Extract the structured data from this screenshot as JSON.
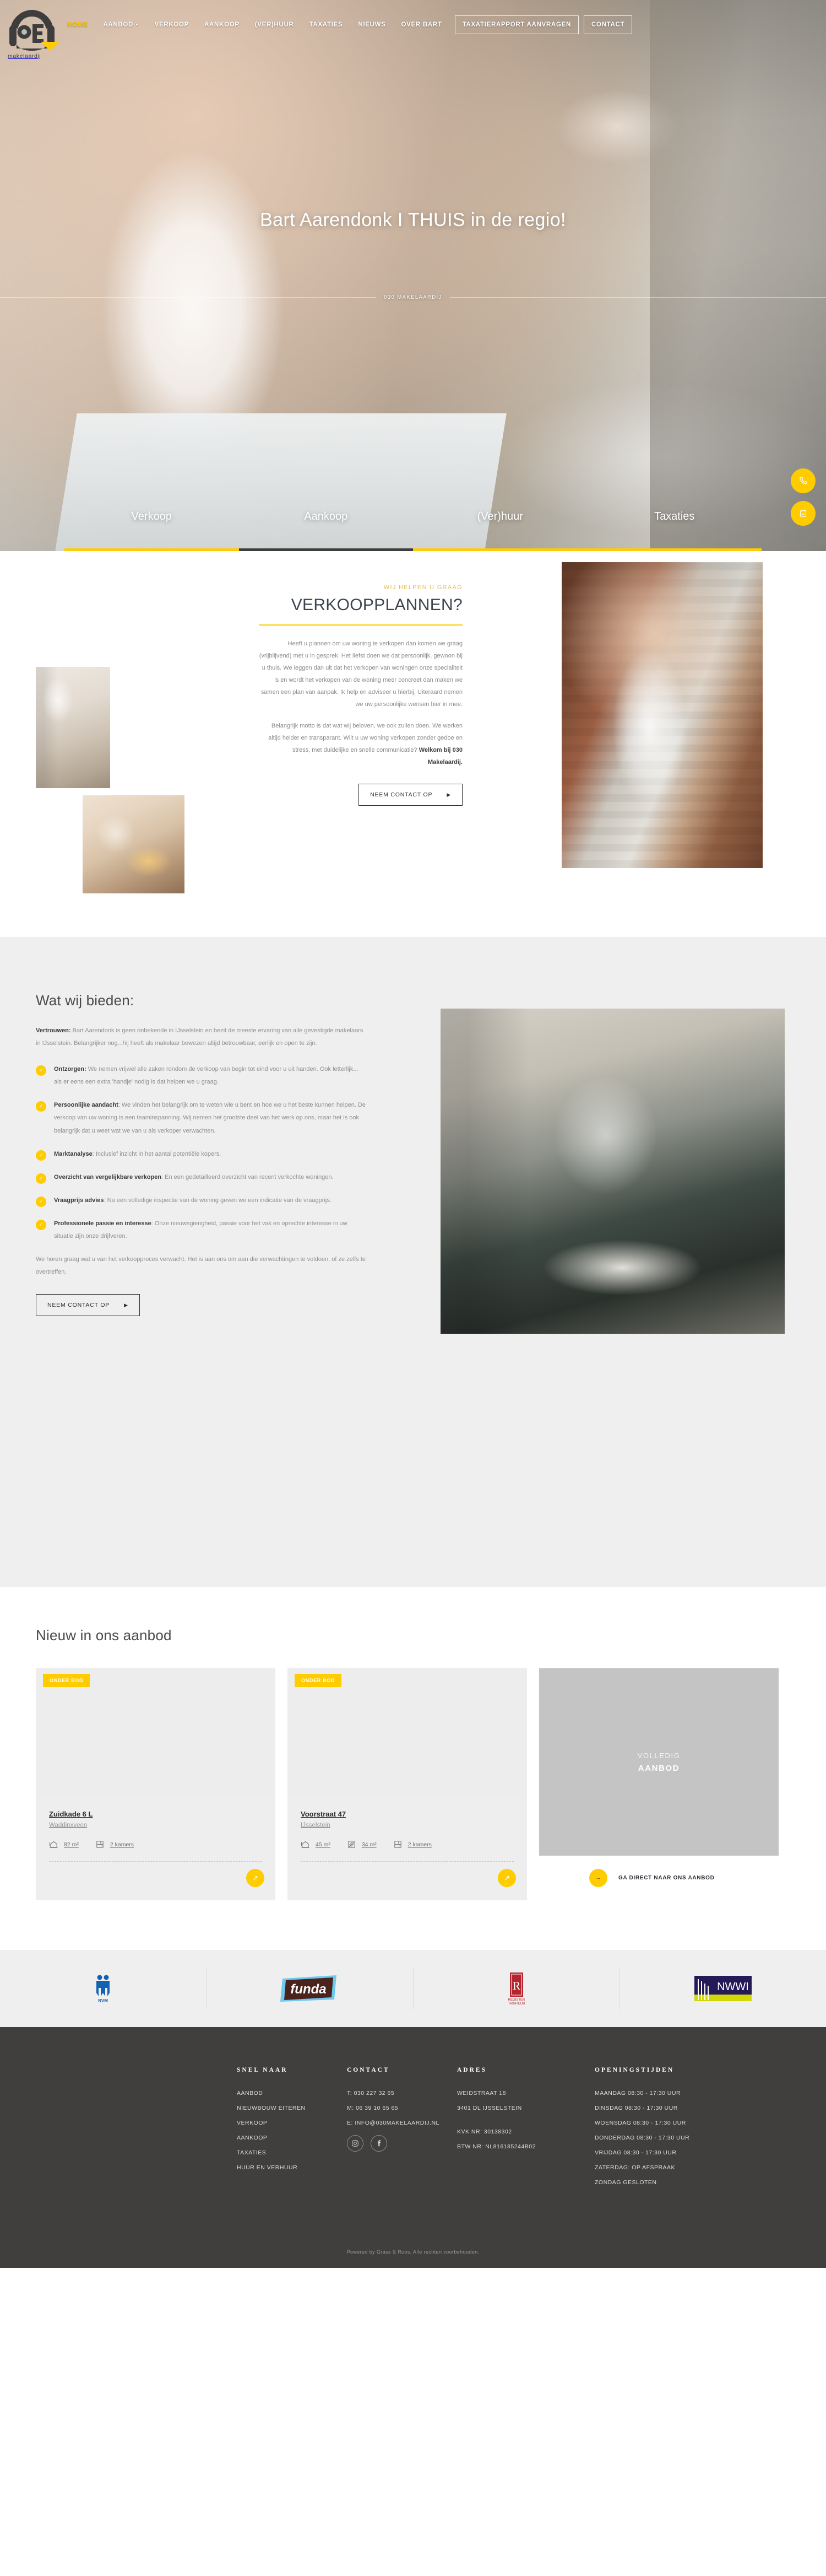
{
  "brand": {
    "logo_number": "030",
    "logo_word": "makelaardij",
    "accent_yellow": "#ffcc00",
    "dark": "#403f3d"
  },
  "nav": {
    "items": [
      {
        "label": "HOME",
        "active": true,
        "caret": false
      },
      {
        "label": "AANBOD",
        "active": false,
        "caret": true
      },
      {
        "label": "VERKOOP",
        "active": false,
        "caret": false
      },
      {
        "label": "AANKOOP",
        "active": false,
        "caret": false
      },
      {
        "label": "(VER)HUUR",
        "active": false,
        "caret": false
      },
      {
        "label": "TAXATIES",
        "active": false,
        "caret": false
      },
      {
        "label": "NIEUWS",
        "active": false,
        "caret": false
      },
      {
        "label": "OVER BART",
        "active": false,
        "caret": false
      }
    ],
    "button_primary": "TAXATIERAPPORT AANVRAGEN",
    "button_secondary": "CONTACT"
  },
  "hero": {
    "title": "Bart Aarendonk I THUIS in de regio!",
    "subtitle": "030 MAKELAARDIJ",
    "tabs": [
      {
        "label": "Verkoop",
        "bar": "yellow"
      },
      {
        "label": "Aankoop",
        "bar": "dark"
      },
      {
        "label": "(Ver)huur",
        "bar": "yellow"
      },
      {
        "label": "Taxaties",
        "bar": "yellow"
      }
    ],
    "float_phone_icon": "phone-icon",
    "float_calendar_icon": "calendar-icon"
  },
  "verkoop": {
    "eyebrow": "WIJ HELPEN U GRAAG",
    "heading": "VERKOOPPLANNEN?",
    "paragraph1": "Heeft u plannen om uw woning te verkopen dan komen we graag (vrijblijvend) met u in gesprek. Het liefst doen we dat persoonlijk, gewoon bij u thuis. We leggen dan uit dat het verkopen van woningen onze specialiteit is en wordt het verkopen van de woning meer concreet dan maken we samen een plan van aanpak. Ik help en adviseer u hierbij. Uiteraard nemen we uw persoonlijke wensen hier in mee.",
    "paragraph2_plain": "Belangrijk motto is dat wat wij beloven, we ook zullen doen. We werken altijd helder en transparant. Wilt u uw woning verkopen zonder gedoe en stress, met duidelijke en snelle communicatie? ",
    "paragraph2_bold": "Welkom bij 030 Makelaardij.",
    "cta": "NEEM CONTACT OP"
  },
  "bieden": {
    "heading": "Wat wij bieden:",
    "intro_bold": "Vertrouwen:",
    "intro_rest": " Bart Aarendonk is geen onbekende in IJsselstein en bezit de meeste ervaring van alle gevestigde makelaars in IJsselstein. Belangrijker nog...hij heeft als makelaar bewezen altijd betrouwbaar, eerlijk en open te zijn.",
    "items": [
      {
        "bold": "Ontzorgen:",
        "text": " We nemen vrijwel alle zaken rondom de verkoop van begin tot eind voor u uit handen. Ook letterlijk... als er eens een extra 'handje' nodig is dat helpen we u graag."
      },
      {
        "bold": "Persoonlijke aandacht",
        "text": ": We vinden het belangrijk om te weten wie u bent en hoe we u het beste kunnen helpen. De verkoop van uw woning is een teaminspanning. Wij nemen het grootste deel van het werk op ons, maar het is ook belangrijk dat u weet wat we van u als verkoper verwachten."
      },
      {
        "bold": "Marktanalyse",
        "text": ": Inclusief inzicht in het aantal potentiële kopers."
      },
      {
        "bold": "Overzicht van vergelijkbare verkopen",
        "text": ": En een gedetailleerd overzicht van recent verkochte woningen."
      },
      {
        "bold": "Vraagprijs advies",
        "text": ": Na een volledige inspectie van de woning geven we een indicatie van de vraagprijs."
      },
      {
        "bold": "Professionele passie en interesse",
        "text": ": Onze nieuwsgierigheid, passie voor het vak en oprechte interesse in uw situatie zijn onze drijfveren."
      }
    ],
    "outro": "We horen graag wat u van het verkoopproces verwacht. Het is aan ons om aan die verwachtingen te voldoen, of ze zelfs te overtreffen.",
    "cta": "NEEM CONTACT OP"
  },
  "aanbod": {
    "heading": "Nieuw in ons aanbod",
    "cards": [
      {
        "badge": "ONDER BOD",
        "title": "Zuidkade 6 L",
        "city": "Waddinxveen",
        "specs": [
          {
            "icon": "house-icon",
            "value": "82 m²"
          },
          {
            "icon": "floorplan-icon",
            "value": "2 kamers"
          }
        ]
      },
      {
        "badge": "ONDER BOD",
        "title": "Voorstraat 47",
        "city": "IJsselstein",
        "specs": [
          {
            "icon": "house-icon",
            "value": "45 m²"
          },
          {
            "icon": "plot-icon",
            "value": "34 m²"
          },
          {
            "icon": "floorplan-icon",
            "value": "2 kamers"
          }
        ]
      }
    ],
    "wide_card": {
      "line1": "VOLLEDIG",
      "line2": "AANBOD",
      "cta": "GA DIRECT NAAR ONS AANBOD"
    }
  },
  "partners": [
    {
      "name": "NVM",
      "label": "NVM"
    },
    {
      "name": "funda",
      "label": "funda"
    },
    {
      "name": "Register Taxateur",
      "label": "R",
      "sub1": "REGISTER",
      "sub2": "TAXATEUR"
    },
    {
      "name": "NWWI",
      "label": "NWWI"
    }
  ],
  "footer": {
    "col_quick": {
      "title": "SNEL NAAR",
      "links": [
        "AANBOD",
        "NIEUWBOUW EITEREN",
        "VERKOOP",
        "AANKOOP",
        "TAXATIES",
        "HUUR EN VERHUUR"
      ]
    },
    "col_contact": {
      "title": "CONTACT",
      "phone": "T: 030 227 32 65",
      "mobile": "M: 06 39 10 65 65",
      "email": "E: INFO@030MAKELAARDIJ.NL",
      "social": [
        {
          "icon": "instagram-icon",
          "glyph": "▣"
        },
        {
          "icon": "facebook-icon",
          "glyph": "f"
        }
      ]
    },
    "col_address": {
      "title": "ADRES",
      "street": "WEIDSTRAAT 18",
      "city": "3401 DL IJSSELSTEIN",
      "kvk": "KVK NR: 30138302",
      "btw": "BTW NR: NL816185244B02"
    },
    "col_hours": {
      "title": "OPENINGSTIJDEN",
      "rows": [
        "MAANDAG 08:30 - 17:30 UUR",
        "DINSDAG 08:30 - 17:30 UUR",
        "WOENSDAG 08:30 - 17:30 UUR",
        "DONDERDAG 08:30 - 17:30 UUR",
        "VRIJDAG 08:30 - 17:30 UUR",
        "ZATERDAG: OP AFSPRAAK",
        "ZONDAG GESLOTEN"
      ]
    },
    "copyright": "Powered by Grass & Roos. Alle rechten voorbehouden."
  }
}
